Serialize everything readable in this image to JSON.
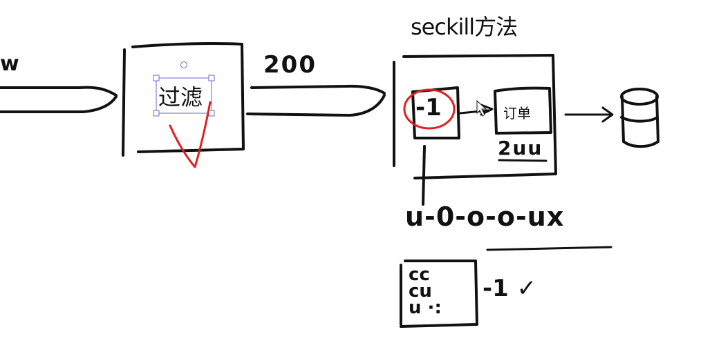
{
  "diagram": {
    "title": "seckill方法",
    "left_edge_text": "w",
    "filter_node": {
      "label": "过滤"
    },
    "edge_count": "200",
    "decrement_node": {
      "label": "-1"
    },
    "order_node": {
      "label": "订单"
    },
    "order_count": "2uu",
    "sequence_text": "u-0-o-o-ux",
    "batch_box": {
      "lines": [
        "cc",
        "cu",
        "u ·:"
      ]
    },
    "batch_suffix": "-1 ✓",
    "colors": {
      "ink": "#111111",
      "annotation": "#e02020",
      "selection": "#6a6ad0"
    }
  }
}
